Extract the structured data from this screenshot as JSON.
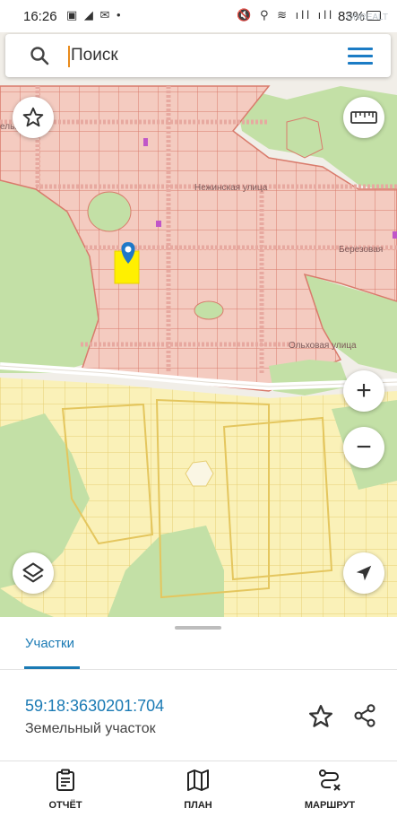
{
  "status_bar": {
    "time": "16:26",
    "left_icons": "▣ ◢ ✉ •",
    "right_icons": "🔇 ⚲ ≋ ıll ıll",
    "battery": "83%",
    "watermark": "ONREALT"
  },
  "search": {
    "placeholder": "Поиск"
  },
  "map": {
    "street_labels": [
      "Нежинская улица",
      "Березовая",
      "Ольховая улица",
      "ельна"
    ],
    "colors": {
      "background": "#f1eee8",
      "residential_fill": "#f4cbc0",
      "residential_line": "#d97b6c",
      "garden_fill": "#faf1b8",
      "garden_line": "#e7ce73",
      "green": "#c3e0a6",
      "selected_parcel": "#fff000",
      "marker": "#1e78c8"
    }
  },
  "controls": {
    "favorite_icon": "star-icon",
    "ruler_icon": "ruler-icon",
    "zoom_in": "+",
    "zoom_out": "−",
    "layers_icon": "layers-icon",
    "locate_icon": "navigation-arrow-icon"
  },
  "sheet": {
    "tab_label": "Участки",
    "parcel_id": "59:18:3630201:704",
    "parcel_type": "Земельный участок"
  },
  "bottom_nav": [
    {
      "label": "ОТЧЁТ",
      "icon": "report-icon"
    },
    {
      "label": "ПЛАН",
      "icon": "map-plan-icon"
    },
    {
      "label": "МАРШРУТ",
      "icon": "route-icon"
    }
  ]
}
